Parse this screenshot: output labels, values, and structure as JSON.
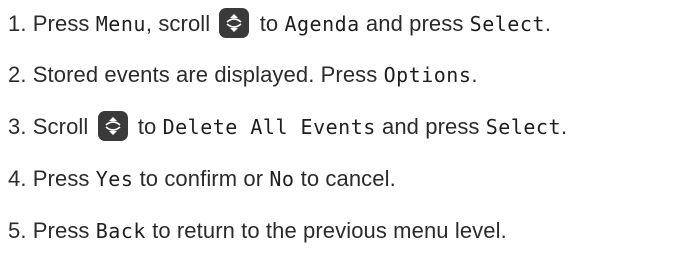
{
  "steps": [
    {
      "num": "1.",
      "parts": {
        "a": "Press ",
        "b": "Menu",
        "c": ", scroll ",
        "icon": "scroll-icon",
        "d": " to ",
        "e": "Agenda",
        "f": " and press ",
        "g": "Select",
        "h": "."
      }
    },
    {
      "num": "2.",
      "parts": {
        "a": "Stored events are displayed. Press ",
        "b": "Options",
        "c": "."
      }
    },
    {
      "num": "3.",
      "parts": {
        "a": "Scroll ",
        "icon": "scroll-icon",
        "b": " to ",
        "c": "Delete All Events",
        "d": " and press ",
        "e": "Select",
        "f": "."
      }
    },
    {
      "num": "4.",
      "parts": {
        "a": "Press ",
        "b": "Yes",
        "c": " to confirm or ",
        "d": "No",
        "e": " to cancel."
      }
    },
    {
      "num": "5.",
      "parts": {
        "a": "Press ",
        "b": "Back",
        "c": " to return to the previous menu level."
      }
    }
  ],
  "colors": {
    "text": "#2b2b2b",
    "icon_bg": "#3a3a3a",
    "icon_fg": "#ffffff"
  }
}
